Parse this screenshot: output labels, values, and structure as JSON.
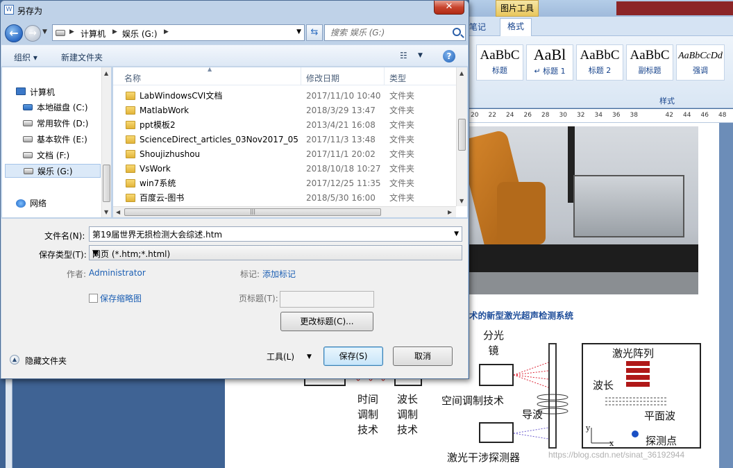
{
  "dialog": {
    "title": "另存为",
    "close_glyph": "✕",
    "nav": {
      "back_glyph": "←",
      "forward_glyph": "→",
      "breadcrumbs": [
        "计算机",
        "娱乐 (G:)"
      ],
      "search_placeholder": "搜索 娱乐 (G:)"
    },
    "toolbar": {
      "organize_label": "组织 ▾",
      "new_folder_label": "新建文件夹",
      "view_glyph": "☷",
      "help_glyph": "?"
    },
    "nav_pane": {
      "computer_label": "计算机",
      "items": [
        "本地磁盘 (C:)",
        "常用软件 (D:)",
        "基本软件 (E:)",
        "文档 (F:)",
        "娱乐 (G:)"
      ],
      "network_label": "网络"
    },
    "file_list": {
      "columns": [
        "名称",
        "修改日期",
        "类型"
      ],
      "rows": [
        {
          "name": "LabWindowsCVI文档",
          "date": "2017/11/10 10:40",
          "type": "文件夹"
        },
        {
          "name": "MatlabWork",
          "date": "2018/3/29 13:47",
          "type": "文件夹"
        },
        {
          "name": "ppt模板2",
          "date": "2013/4/21 16:08",
          "type": "文件夹"
        },
        {
          "name": "ScienceDirect_articles_03Nov2017_05...",
          "date": "2017/11/3 13:48",
          "type": "文件夹"
        },
        {
          "name": "Shoujizhushou",
          "date": "2017/11/1 20:02",
          "type": "文件夹"
        },
        {
          "name": "VsWork",
          "date": "2018/10/18 10:27",
          "type": "文件夹"
        },
        {
          "name": "win7系统",
          "date": "2017/12/25 11:35",
          "type": "文件夹"
        },
        {
          "name": "百度云-图书",
          "date": "2018/5/30 16:00",
          "type": "文件夹"
        }
      ]
    },
    "form": {
      "filename_label": "文件名(N):",
      "filename_value": "第19届世界无损检测大会综述.htm",
      "savetype_label": "保存类型(T):",
      "savetype_value": "网页 (*.htm;*.html)",
      "author_label": "作者:",
      "author_value": "Administrator",
      "tags_label": "标记:",
      "tags_value": "添加标记",
      "thumbnail_label": "保存缩略图",
      "page_title_label": "页标题(T):",
      "change_title_label": "更改标题(C)...",
      "tools_label": "工具(L)",
      "save_label": "保存(S)",
      "cancel_label": "取消",
      "hide_folders_label": "隐藏文件夹"
    }
  },
  "word": {
    "picture_tools_tab": "图片工具",
    "tabs": [
      "笔记",
      "格式"
    ],
    "styles": [
      {
        "sample": "AaBbC",
        "label": "标题"
      },
      {
        "sample": "AaBl",
        "label": "↵ 标题 1"
      },
      {
        "sample": "AaBbC",
        "label": "标题 2"
      },
      {
        "sample": "AaBbC",
        "label": "副标题"
      },
      {
        "sample": "AaBbCcDd",
        "label": "强调"
      }
    ],
    "styles_group_label": "样式",
    "ruler_ticks": [
      "20",
      "22",
      "24",
      "26",
      "28",
      "30",
      "32",
      "34",
      "36",
      "38",
      "42",
      "44",
      "46",
      "48"
    ],
    "caption": "术的新型激光超声检测系统",
    "diagram": {
      "beam_splitter": "分光\n镜",
      "laser_array": "激光阵列",
      "wavelength": "波长",
      "plane_wave": "平面波",
      "probe_point": "探测点",
      "guided_wave": "导波",
      "spatial_mod": "空间调制技术",
      "time_mod": "时间\n调制\n技术",
      "wave_mod": "波长\n调制\n技术",
      "interferometer": "激光干涉探测器",
      "axis_y": "y",
      "axis_x": "x"
    },
    "watermark": "https://blog.csdn.net/sinat_36192944"
  }
}
